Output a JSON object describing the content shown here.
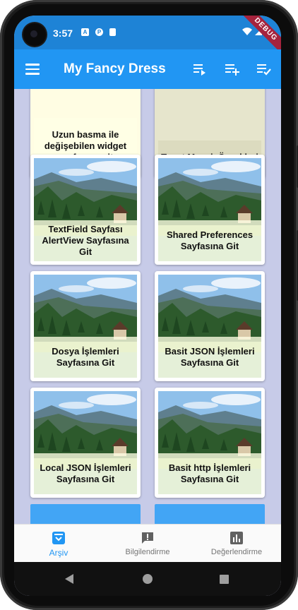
{
  "status_bar": {
    "time": "3:57",
    "debug_label": "DEBUG"
  },
  "app_bar": {
    "title": "My Fancy Dress"
  },
  "grid": {
    "items": [
      {
        "label": "Uzun basma ile değişebilen widget sayfasına git"
      },
      {
        "label": "Toast Mesajı Örnekleri"
      },
      {
        "label": "TextField Sayfası AlertView Sayfasına Git"
      },
      {
        "label": "Shared Preferences Sayfasına Git"
      },
      {
        "label": "Dosya İşlemleri Sayfasına Git"
      },
      {
        "label": "Basit JSON İşlemleri Sayfasına Git"
      },
      {
        "label": "Local JSON İşlemleri Sayfasına Git"
      },
      {
        "label": "Basit http İşlemleri Sayfasına Git"
      }
    ]
  },
  "bottom_nav": {
    "items": [
      {
        "label": "Arşiv",
        "icon": "archive-icon",
        "active": true
      },
      {
        "label": "Bilgilendirme",
        "icon": "feedback-icon",
        "active": false
      },
      {
        "label": "Değerlendirme",
        "icon": "chart-icon",
        "active": false
      }
    ]
  },
  "colors": {
    "primary": "#2196f3",
    "status_bar": "#1e83d6",
    "background": "#c7cbe8",
    "card_label_bg": "#fffde3"
  }
}
